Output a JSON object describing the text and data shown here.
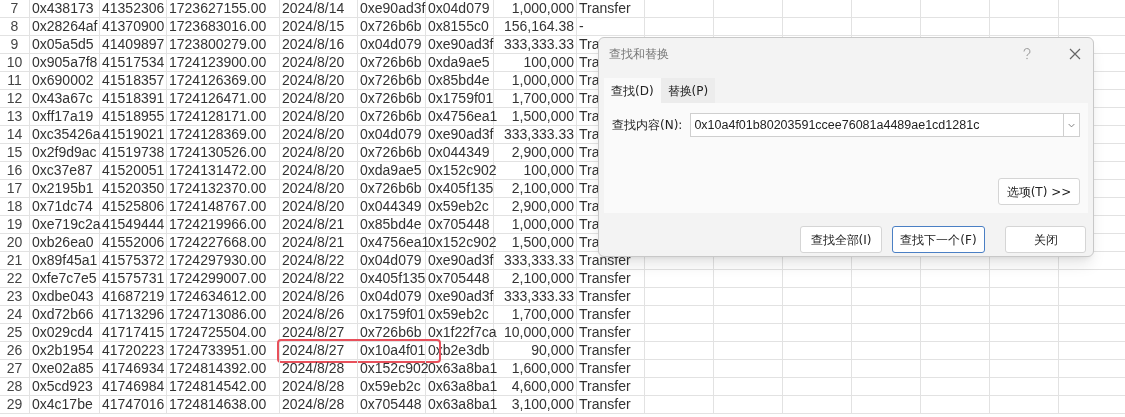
{
  "sheet": {
    "rows": [
      {
        "row_number": "7",
        "highlighted": false,
        "cells": [
          "0x438173",
          "41352306",
          "1723627155.00",
          "2024/8/14",
          "0xe90ad3f",
          "0x04d079",
          "1,000,000",
          "Transfer"
        ]
      },
      {
        "row_number": "8",
        "highlighted": false,
        "cells": [
          "0x28264af",
          "41370900",
          "1723683016.00",
          "2024/8/15",
          "0x726b6b",
          "0x8155c0",
          "156,164.38",
          "-"
        ]
      },
      {
        "row_number": "9",
        "highlighted": false,
        "cells": [
          "0x05a5d5",
          "41409897",
          "1723800279.00",
          "2024/8/16",
          "0x04d079",
          "0xe90ad3f",
          "333,333.33",
          "Tra"
        ]
      },
      {
        "row_number": "10",
        "highlighted": false,
        "cells": [
          "0x905a7f8",
          "41517534",
          "1724123900.00",
          "2024/8/20",
          "0x726b6b",
          "0xda9ae5",
          "100,000",
          "Tra"
        ]
      },
      {
        "row_number": "11",
        "highlighted": false,
        "cells": [
          "0x690002",
          "41518357",
          "1724126369.00",
          "2024/8/20",
          "0x726b6b",
          "0x85bd4e",
          "1,000,000",
          "Tra"
        ]
      },
      {
        "row_number": "12",
        "highlighted": false,
        "cells": [
          "0x43a67c",
          "41518391",
          "1724126471.00",
          "2024/8/20",
          "0x726b6b",
          "0x1759f01",
          "1,700,000",
          "Tra"
        ]
      },
      {
        "row_number": "13",
        "highlighted": false,
        "cells": [
          "0xff17a19",
          "41518955",
          "1724128171.00",
          "2024/8/20",
          "0x726b6b",
          "0x4756ea1",
          "1,500,000",
          "Tra"
        ]
      },
      {
        "row_number": "14",
        "highlighted": false,
        "cells": [
          "0xc35426a",
          "41519021",
          "1724128369.00",
          "2024/8/20",
          "0x04d079",
          "0xe90ad3f",
          "333,333.33",
          "Tra"
        ]
      },
      {
        "row_number": "15",
        "highlighted": false,
        "cells": [
          "0x2f9d9ac",
          "41519738",
          "1724130526.00",
          "2024/8/20",
          "0x726b6b",
          "0x044349",
          "2,900,000",
          "Tra"
        ]
      },
      {
        "row_number": "16",
        "highlighted": false,
        "cells": [
          "0xc37e87",
          "41520051",
          "1724131472.00",
          "2024/8/20",
          "0xda9ae5",
          "0x152c902",
          "100,000",
          "Tra"
        ]
      },
      {
        "row_number": "17",
        "highlighted": false,
        "cells": [
          "0x2195b1",
          "41520350",
          "1724132370.00",
          "2024/8/20",
          "0x726b6b",
          "0x405f135",
          "2,100,000",
          "Tra"
        ]
      },
      {
        "row_number": "18",
        "highlighted": false,
        "cells": [
          "0x71dc74",
          "41525806",
          "1724148767.00",
          "2024/8/20",
          "0x044349",
          "0x59eb2c",
          "2,900,000",
          "Tra"
        ]
      },
      {
        "row_number": "19",
        "highlighted": false,
        "cells": [
          "0xe719c2a",
          "41549444",
          "1724219966.00",
          "2024/8/21",
          "0x85bd4e",
          "0x705448",
          "1,000,000",
          "Tra"
        ]
      },
      {
        "row_number": "20",
        "highlighted": false,
        "cells": [
          "0xb26ea0",
          "41552006",
          "1724227668.00",
          "2024/8/21",
          "0x4756ea1",
          "0x152c902",
          "1,500,000",
          "Tra"
        ]
      },
      {
        "row_number": "21",
        "highlighted": false,
        "cells": [
          "0x89f45a1",
          "41575372",
          "1724297930.00",
          "2024/8/22",
          "0x04d079",
          "0xe90ad3f",
          "333,333.33",
          "Transfer"
        ]
      },
      {
        "row_number": "22",
        "highlighted": false,
        "cells": [
          "0xfe7c7e5",
          "41575731",
          "1724299007.00",
          "2024/8/22",
          "0x405f135",
          "0x705448",
          "2,100,000",
          "Transfer"
        ]
      },
      {
        "row_number": "23",
        "highlighted": false,
        "cells": [
          "0xdbe043",
          "41687219",
          "1724634612.00",
          "2024/8/26",
          "0x04d079",
          "0xe90ad3f",
          "333,333.33",
          "Transfer"
        ]
      },
      {
        "row_number": "24",
        "highlighted": false,
        "cells": [
          "0xd72b66",
          "41713296",
          "1724713086.00",
          "2024/8/26",
          "0x1759f01",
          "0x59eb2c",
          "1,700,000",
          "Transfer"
        ]
      },
      {
        "row_number": "25",
        "highlighted": false,
        "cells": [
          "0x029cd4",
          "41717415",
          "1724725504.00",
          "2024/8/27",
          "0x726b6b",
          "0x1f22f7ca",
          "10,000,000",
          "Transfer"
        ]
      },
      {
        "row_number": "26",
        "highlighted": true,
        "cells": [
          "0x2b1954",
          "41720223",
          "1724733951.00",
          "2024/8/27",
          "0x10a4f01",
          "0xb2e3db",
          "90,000",
          "Transfer"
        ]
      },
      {
        "row_number": "27",
        "highlighted": false,
        "cells": [
          "0xe02a85",
          "41746934",
          "1724814392.00",
          "2024/8/28",
          "0x152c902",
          "0x63a8ba1",
          "1,600,000",
          "Transfer"
        ]
      },
      {
        "row_number": "28",
        "highlighted": false,
        "cells": [
          "0x5cd923",
          "41746984",
          "1724814542.00",
          "2024/8/28",
          "0x59eb2c",
          "0x63a8ba1",
          "4,600,000",
          "Transfer"
        ]
      },
      {
        "row_number": "29",
        "highlighted": false,
        "cells": [
          "0x4c17be",
          "41747016",
          "1724814638.00",
          "2024/8/28",
          "0x705448",
          "0x63a8ba1",
          "3,100,000",
          "Transfer"
        ]
      }
    ]
  },
  "dialog": {
    "title": "查找和替换",
    "tabs": [
      {
        "label": "查找(D)",
        "selected": true
      },
      {
        "label": "替换(P)",
        "selected": false
      }
    ],
    "find_label": "查找内容(N):",
    "find_value": "0x10a4f01b80203591ccee76081a4489ae1cd1281c",
    "options_button": "选项(T) >>",
    "buttons": [
      {
        "label": "查找全部(I)",
        "default": false
      },
      {
        "label": "查找下一个(F)",
        "default": true
      },
      {
        "label": "关闭",
        "default": false
      }
    ]
  }
}
